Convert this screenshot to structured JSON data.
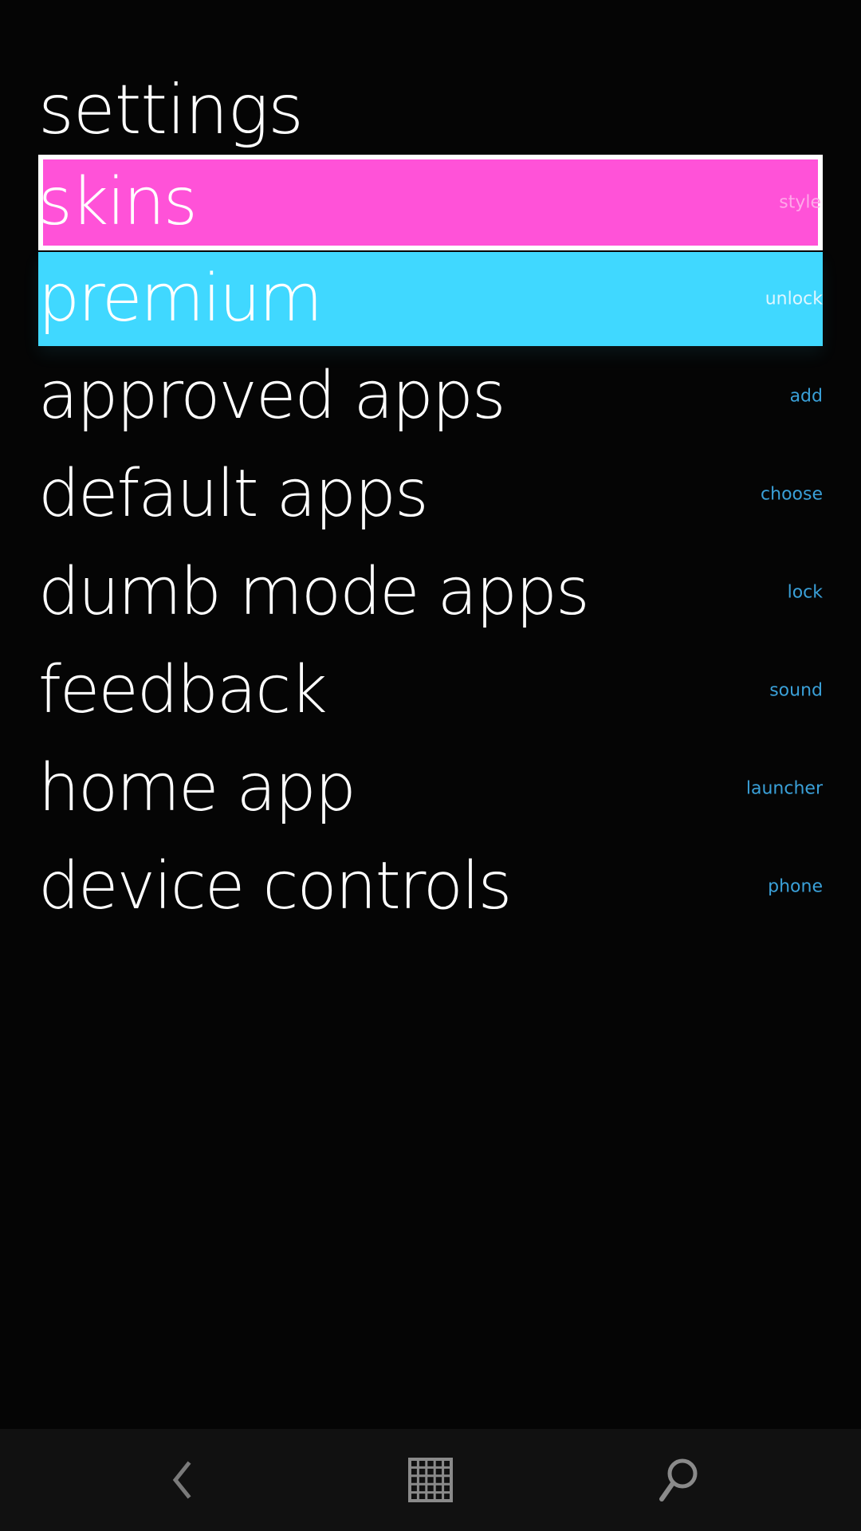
{
  "page": {
    "title": "settings"
  },
  "menu": {
    "items": [
      {
        "label": "skins",
        "hint": "style",
        "bg": "#ff52d8"
      },
      {
        "label": "premium",
        "hint": "unlock",
        "bg": "#40d8ff"
      },
      {
        "label": "approved apps",
        "hint": "add"
      },
      {
        "label": "default apps",
        "hint": "choose"
      },
      {
        "label": "dumb mode apps",
        "hint": "lock"
      },
      {
        "label": "feedback",
        "hint": "sound"
      },
      {
        "label": "home app",
        "hint": "launcher"
      },
      {
        "label": "device controls",
        "hint": "phone"
      }
    ]
  },
  "navbar": {
    "icons": [
      "back-icon",
      "app-grid-icon",
      "search-icon"
    ]
  },
  "colors": {
    "background": "#050505",
    "accent_hint": "#3aa0d8",
    "skins": "#ff52d8",
    "premium": "#40d8ff",
    "navbar": "#111111"
  }
}
